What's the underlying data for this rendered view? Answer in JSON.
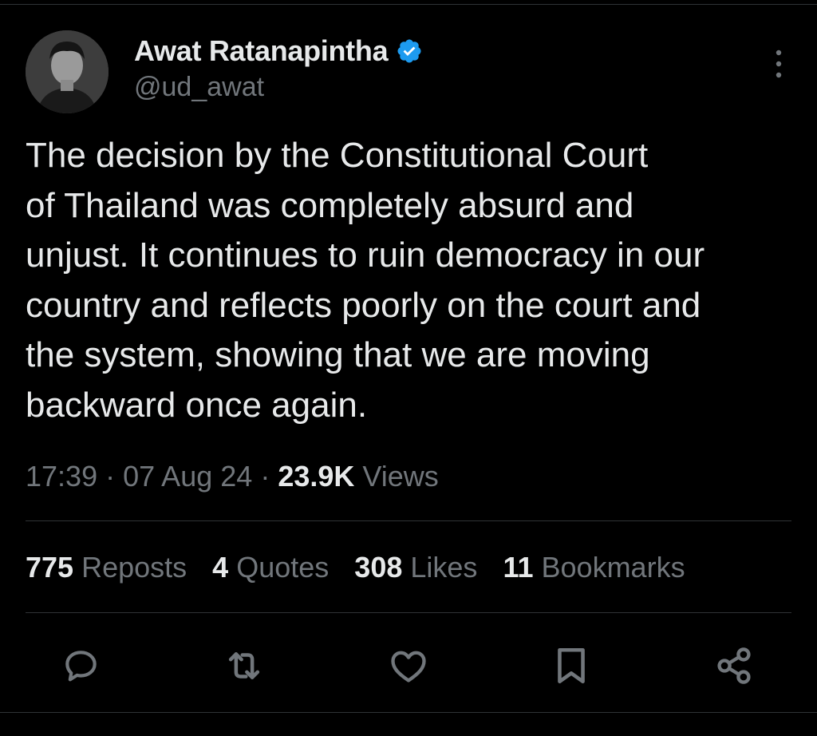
{
  "author": {
    "display_name": "Awat Ratanapintha",
    "handle": "@ud_awat",
    "verified": true
  },
  "tweet": {
    "text": "The decision by the Constitutional Court\nof Thailand was completely absurd and\nunjust. It continues to ruin democracy in our\ncountry and reflects poorly on the court and\nthe system, showing that we are moving\nbackward once again.",
    "time": "17:39",
    "date": "07 Aug 24",
    "separator": "·",
    "views_count": "23.9K",
    "views_label": "Views"
  },
  "stats": {
    "reposts": {
      "count": "775",
      "label": "Reposts"
    },
    "quotes": {
      "count": "4",
      "label": "Quotes"
    },
    "likes": {
      "count": "308",
      "label": "Likes"
    },
    "bookmarks": {
      "count": "11",
      "label": "Bookmarks"
    }
  },
  "actions": [
    "reply-icon",
    "repost-icon",
    "like-icon",
    "bookmark-icon",
    "share-icon"
  ],
  "colors": {
    "background": "#000000",
    "text_primary": "#e7e9ea",
    "text_secondary": "#71767b",
    "verified_blue": "#1d9bf0",
    "divider": "#2f3336"
  }
}
